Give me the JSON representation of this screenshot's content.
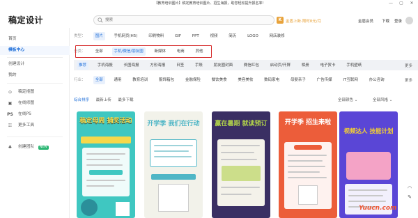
{
  "window": {
    "title": "【教育培训图片】稿定教育培训图片、招生海报，助您轻松提升报名率!",
    "controls": [
      "—",
      "▢",
      "✕"
    ]
  },
  "header": {
    "logo": "稿定设计",
    "search_placeholder": "搜索",
    "vip_badge": "K",
    "vip_text": "金盾上新·限时8元/月",
    "links": [
      "金盾会员",
      "下载",
      "登录"
    ]
  },
  "sidebar": {
    "items": [
      {
        "label": "首页",
        "icon": ""
      },
      {
        "label": "模板中心",
        "icon": "",
        "active": true
      },
      {
        "label": "创建设计",
        "icon": ""
      },
      {
        "label": "我的",
        "icon": ""
      },
      {
        "label": "稿定抠图",
        "icon": "⊙"
      },
      {
        "label": "在线修图",
        "icon": "▣"
      },
      {
        "label": "在线PS",
        "icon": "PS"
      },
      {
        "label": "更多工具",
        "icon": "☷"
      },
      {
        "label": "创建团队",
        "icon": "♣",
        "badge": "NEW"
      }
    ]
  },
  "filters": {
    "type": {
      "label": "类型：",
      "options": [
        "图片",
        "手机网页(H5)",
        "印刷物料",
        "GIF",
        "PPT",
        "视频",
        "简历",
        "LOGO",
        "网店装修"
      ],
      "selected": 0
    },
    "category": {
      "label": "分类：",
      "options": [
        "全部",
        "手机/微信/朋友圈",
        "新媒体",
        "电商",
        "其他"
      ],
      "selected": 1
    },
    "sub": {
      "options": [
        "推荐",
        "手机海报",
        "长图海报",
        "方形海报",
        "日签",
        "手账",
        "朋友圈封面",
        "微信红包",
        "启动页/开屏",
        "相册",
        "电子贺卡",
        "手机壁纸"
      ],
      "selected": 0,
      "more": "更多"
    },
    "industry": {
      "label": "行业：",
      "options": [
        "全部",
        "通用",
        "教育培训",
        "服饰箱包",
        "金融保险",
        "餐饮美食",
        "美容美妆",
        "数码家电",
        "母婴亲子",
        "广告传媒",
        "IT互联网",
        "办公咨询"
      ],
      "selected": 0,
      "more": "更多"
    }
  },
  "sort": {
    "options": [
      "综合排序",
      "最新上传",
      "最多下载"
    ],
    "selected": 0,
    "color_filter": "全部颜色 ⌄",
    "style_filter": "全部风格 ⌄"
  },
  "cards": [
    {
      "title": "稿定母周 捕奖活动",
      "colors": {
        "bg": "#3fc7c1",
        "accent": "#f6d84a"
      }
    },
    {
      "title": "开学季 我们在行动",
      "colors": {
        "bg": "#f2f2ea",
        "accent": "#4fb6c6"
      }
    },
    {
      "title": "赢在暑期 就读预订",
      "colors": {
        "bg": "#3a2f63",
        "accent": "#b0d14a"
      }
    },
    {
      "title": "开学季 招生来啦",
      "colors": {
        "bg": "#ec5d3a",
        "accent": "#ffffff"
      }
    },
    {
      "title": "视频达人 技能计划",
      "colors": {
        "bg": "#5a46d6",
        "accent": "#f6d230"
      }
    }
  ],
  "watermark": "Yuucn.com"
}
